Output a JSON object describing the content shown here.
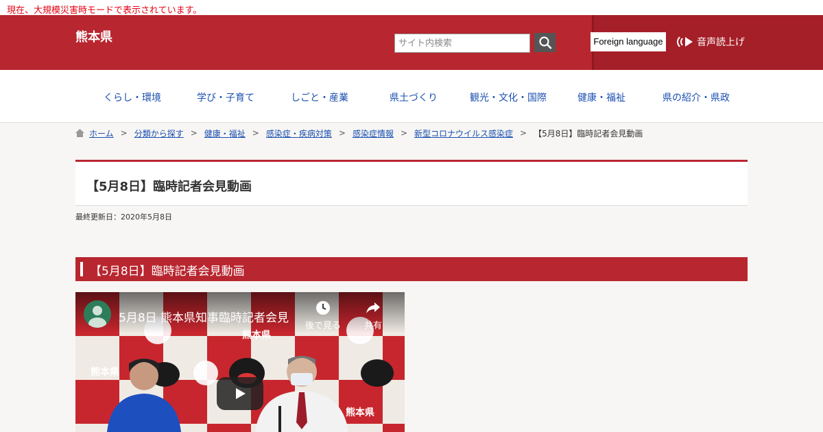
{
  "disaster_notice": "現在、大規模災害時モードで表示されています。",
  "header": {
    "site_title": "熊本県",
    "search_placeholder": "サイト内検索",
    "foreign_language": "Foreign language",
    "voice_reader": "音声読上げ"
  },
  "nav": {
    "items": [
      {
        "label": "くらし・環境"
      },
      {
        "label": "学び・子育て"
      },
      {
        "label": "しごと・産業"
      },
      {
        "label": "県土づくり"
      },
      {
        "label": "観光・文化・国際"
      },
      {
        "label": "健康・福祉"
      },
      {
        "label": "県の紹介・県政"
      }
    ]
  },
  "breadcrumb": {
    "items": [
      "ホーム",
      "分類から探す",
      "健康・福祉",
      "感染症・疾病対策",
      "感染症情報",
      "新型コロナウイルス感染症"
    ],
    "separator": ">",
    "current": "【5月8日】臨時記者会見動画"
  },
  "page": {
    "title": "【5月8日】臨時記者会見動画",
    "updated": "最終更新日：2020年5月8日",
    "section_heading": "【5月8日】臨時記者会見動画"
  },
  "video": {
    "title": "5月8日 熊本県知事臨時記者会見",
    "watch_later": "後で見る",
    "share": "共有",
    "backdrop_text": "熊本県"
  },
  "colors": {
    "brand_red": "#b8262f",
    "link_blue": "#1a4fb0",
    "notice_red": "#e60012"
  }
}
